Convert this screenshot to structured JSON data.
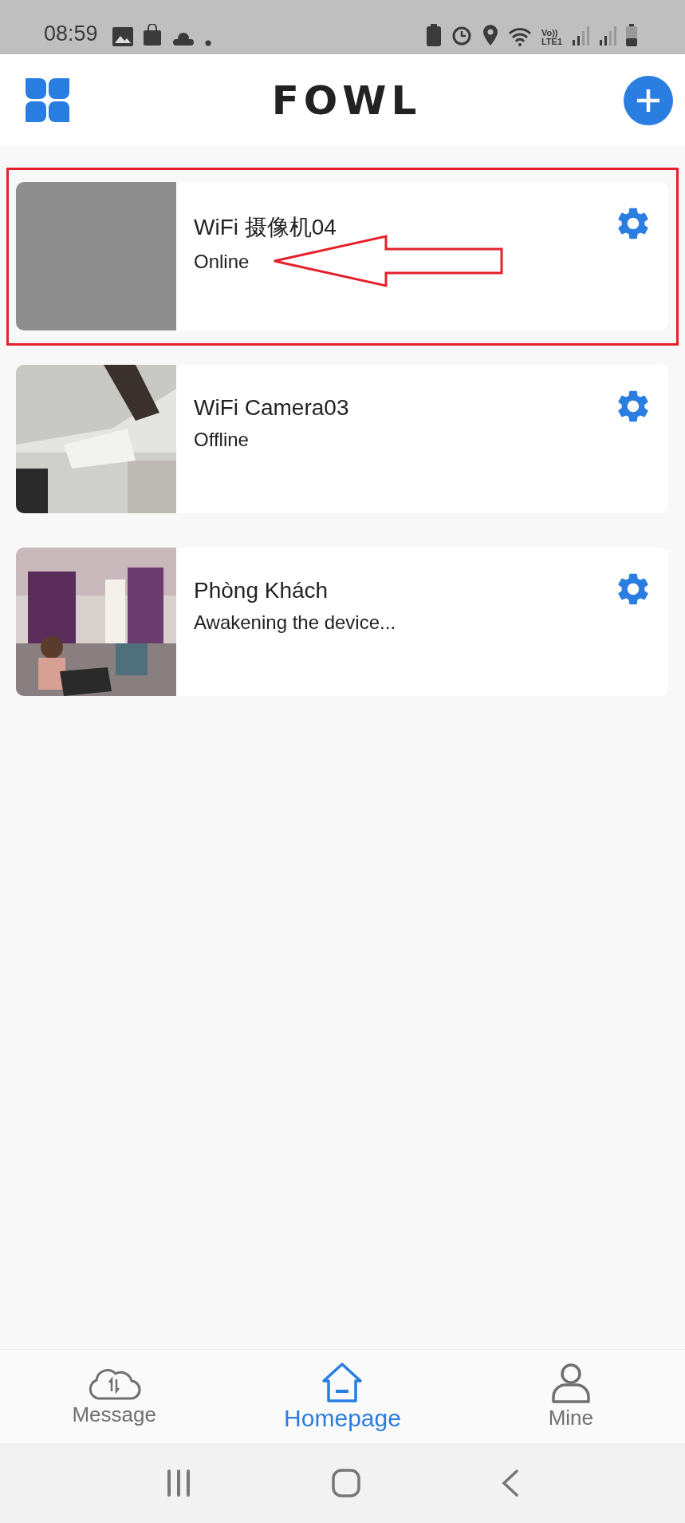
{
  "status_bar": {
    "time": "08:59",
    "volte_label": "Vo))",
    "lte_label": "LTE1"
  },
  "header": {
    "logo": "FOWL"
  },
  "devices": [
    {
      "name": "WiFi 摄像机04",
      "status": "Online",
      "thumbnail": {
        "kind": "blank"
      },
      "highlighted": true
    },
    {
      "name": "WiFi Camera03",
      "status": "Offline",
      "highlighted": false
    },
    {
      "name": "Phòng Khách",
      "status": "Awakening the device...",
      "highlighted": false
    }
  ],
  "tabs": [
    {
      "kind": "message",
      "label": "Message",
      "selected": false
    },
    {
      "kind": "home",
      "label": "Homepage",
      "selected": true
    },
    {
      "kind": "mine",
      "label": "Mine",
      "selected": false
    }
  ]
}
